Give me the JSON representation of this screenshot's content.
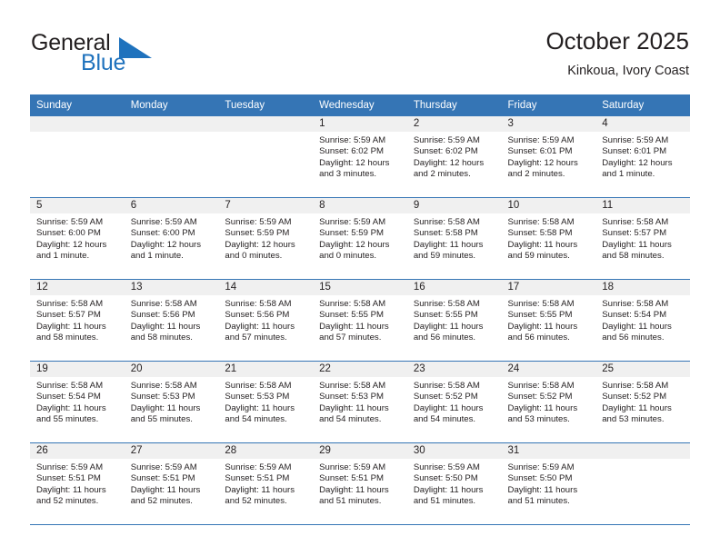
{
  "brand": {
    "name_top": "General",
    "name_bottom": "Blue",
    "flag_icon": "triangle-flag-icon",
    "color_blue": "#1f72bd",
    "color_dark": "#231f20"
  },
  "header": {
    "title": "October 2025",
    "subtitle": "Kinkoua, Ivory Coast"
  },
  "theme": {
    "header_bg": "#3575b5",
    "datebar_bg": "#f0f0f0",
    "text": "#231f20"
  },
  "weekdays": [
    "Sunday",
    "Monday",
    "Tuesday",
    "Wednesday",
    "Thursday",
    "Friday",
    "Saturday"
  ],
  "weeks": [
    [
      {
        "empty": true
      },
      {
        "empty": true
      },
      {
        "empty": true
      },
      {
        "date": "1",
        "sunrise": "Sunrise: 5:59 AM",
        "sunset": "Sunset: 6:02 PM",
        "daylight": "Daylight: 12 hours and 3 minutes."
      },
      {
        "date": "2",
        "sunrise": "Sunrise: 5:59 AM",
        "sunset": "Sunset: 6:02 PM",
        "daylight": "Daylight: 12 hours and 2 minutes."
      },
      {
        "date": "3",
        "sunrise": "Sunrise: 5:59 AM",
        "sunset": "Sunset: 6:01 PM",
        "daylight": "Daylight: 12 hours and 2 minutes."
      },
      {
        "date": "4",
        "sunrise": "Sunrise: 5:59 AM",
        "sunset": "Sunset: 6:01 PM",
        "daylight": "Daylight: 12 hours and 1 minute."
      }
    ],
    [
      {
        "date": "5",
        "sunrise": "Sunrise: 5:59 AM",
        "sunset": "Sunset: 6:00 PM",
        "daylight": "Daylight: 12 hours and 1 minute."
      },
      {
        "date": "6",
        "sunrise": "Sunrise: 5:59 AM",
        "sunset": "Sunset: 6:00 PM",
        "daylight": "Daylight: 12 hours and 1 minute."
      },
      {
        "date": "7",
        "sunrise": "Sunrise: 5:59 AM",
        "sunset": "Sunset: 5:59 PM",
        "daylight": "Daylight: 12 hours and 0 minutes."
      },
      {
        "date": "8",
        "sunrise": "Sunrise: 5:59 AM",
        "sunset": "Sunset: 5:59 PM",
        "daylight": "Daylight: 12 hours and 0 minutes."
      },
      {
        "date": "9",
        "sunrise": "Sunrise: 5:58 AM",
        "sunset": "Sunset: 5:58 PM",
        "daylight": "Daylight: 11 hours and 59 minutes."
      },
      {
        "date": "10",
        "sunrise": "Sunrise: 5:58 AM",
        "sunset": "Sunset: 5:58 PM",
        "daylight": "Daylight: 11 hours and 59 minutes."
      },
      {
        "date": "11",
        "sunrise": "Sunrise: 5:58 AM",
        "sunset": "Sunset: 5:57 PM",
        "daylight": "Daylight: 11 hours and 58 minutes."
      }
    ],
    [
      {
        "date": "12",
        "sunrise": "Sunrise: 5:58 AM",
        "sunset": "Sunset: 5:57 PM",
        "daylight": "Daylight: 11 hours and 58 minutes."
      },
      {
        "date": "13",
        "sunrise": "Sunrise: 5:58 AM",
        "sunset": "Sunset: 5:56 PM",
        "daylight": "Daylight: 11 hours and 58 minutes."
      },
      {
        "date": "14",
        "sunrise": "Sunrise: 5:58 AM",
        "sunset": "Sunset: 5:56 PM",
        "daylight": "Daylight: 11 hours and 57 minutes."
      },
      {
        "date": "15",
        "sunrise": "Sunrise: 5:58 AM",
        "sunset": "Sunset: 5:55 PM",
        "daylight": "Daylight: 11 hours and 57 minutes."
      },
      {
        "date": "16",
        "sunrise": "Sunrise: 5:58 AM",
        "sunset": "Sunset: 5:55 PM",
        "daylight": "Daylight: 11 hours and 56 minutes."
      },
      {
        "date": "17",
        "sunrise": "Sunrise: 5:58 AM",
        "sunset": "Sunset: 5:55 PM",
        "daylight": "Daylight: 11 hours and 56 minutes."
      },
      {
        "date": "18",
        "sunrise": "Sunrise: 5:58 AM",
        "sunset": "Sunset: 5:54 PM",
        "daylight": "Daylight: 11 hours and 56 minutes."
      }
    ],
    [
      {
        "date": "19",
        "sunrise": "Sunrise: 5:58 AM",
        "sunset": "Sunset: 5:54 PM",
        "daylight": "Daylight: 11 hours and 55 minutes."
      },
      {
        "date": "20",
        "sunrise": "Sunrise: 5:58 AM",
        "sunset": "Sunset: 5:53 PM",
        "daylight": "Daylight: 11 hours and 55 minutes."
      },
      {
        "date": "21",
        "sunrise": "Sunrise: 5:58 AM",
        "sunset": "Sunset: 5:53 PM",
        "daylight": "Daylight: 11 hours and 54 minutes."
      },
      {
        "date": "22",
        "sunrise": "Sunrise: 5:58 AM",
        "sunset": "Sunset: 5:53 PM",
        "daylight": "Daylight: 11 hours and 54 minutes."
      },
      {
        "date": "23",
        "sunrise": "Sunrise: 5:58 AM",
        "sunset": "Sunset: 5:52 PM",
        "daylight": "Daylight: 11 hours and 54 minutes."
      },
      {
        "date": "24",
        "sunrise": "Sunrise: 5:58 AM",
        "sunset": "Sunset: 5:52 PM",
        "daylight": "Daylight: 11 hours and 53 minutes."
      },
      {
        "date": "25",
        "sunrise": "Sunrise: 5:58 AM",
        "sunset": "Sunset: 5:52 PM",
        "daylight": "Daylight: 11 hours and 53 minutes."
      }
    ],
    [
      {
        "date": "26",
        "sunrise": "Sunrise: 5:59 AM",
        "sunset": "Sunset: 5:51 PM",
        "daylight": "Daylight: 11 hours and 52 minutes."
      },
      {
        "date": "27",
        "sunrise": "Sunrise: 5:59 AM",
        "sunset": "Sunset: 5:51 PM",
        "daylight": "Daylight: 11 hours and 52 minutes."
      },
      {
        "date": "28",
        "sunrise": "Sunrise: 5:59 AM",
        "sunset": "Sunset: 5:51 PM",
        "daylight": "Daylight: 11 hours and 52 minutes."
      },
      {
        "date": "29",
        "sunrise": "Sunrise: 5:59 AM",
        "sunset": "Sunset: 5:51 PM",
        "daylight": "Daylight: 11 hours and 51 minutes."
      },
      {
        "date": "30",
        "sunrise": "Sunrise: 5:59 AM",
        "sunset": "Sunset: 5:50 PM",
        "daylight": "Daylight: 11 hours and 51 minutes."
      },
      {
        "date": "31",
        "sunrise": "Sunrise: 5:59 AM",
        "sunset": "Sunset: 5:50 PM",
        "daylight": "Daylight: 11 hours and 51 minutes."
      },
      {
        "empty": true
      }
    ]
  ]
}
